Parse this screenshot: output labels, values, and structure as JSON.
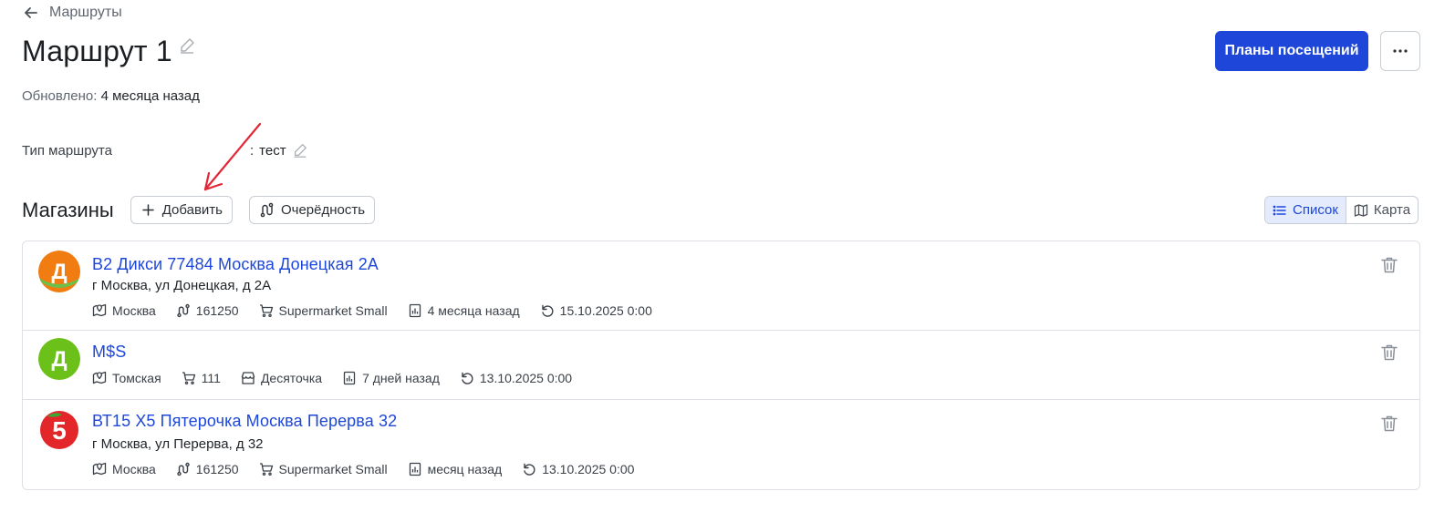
{
  "nav": {
    "back_label": "Маршруты"
  },
  "header": {
    "title": "Маршрут 1",
    "updated_label": "Обновлено:",
    "updated_value": "4 месяца назад",
    "primary_button": "Планы посещений"
  },
  "route_type": {
    "label": "Тип маршрута",
    "separator": ":",
    "value": "тест"
  },
  "stores": {
    "title": "Магазины",
    "add_button": "Добавить",
    "order_button": "Очерёдность",
    "view_list": "Список",
    "view_map": "Карта",
    "items": [
      {
        "name": "В2 Дикси 77484 Москва Донецкая 2А",
        "address": "г Москва, ул Донецкая, д 2А",
        "logo_letter": "Д",
        "region": "Москва",
        "route_code": "161250",
        "format": "Supermarket Small",
        "visited": "4 месяца назад",
        "next": "15.10.2025 0:00"
      },
      {
        "name": "M$S",
        "address": "",
        "logo_letter": "Д",
        "region": "Томская",
        "format": "111",
        "chain": "Десяточка",
        "visited": "7 дней назад",
        "next": "13.10.2025 0:00"
      },
      {
        "name": "ВТ15 Х5 Пятерочка Москва Перерва 32",
        "address": "г Москва, ул Перерва, д 32",
        "logo_letter": "5",
        "region": "Москва",
        "route_code": "161250",
        "format": "Supermarket Small",
        "visited": "месяц назад",
        "next": "13.10.2025 0:00"
      }
    ]
  },
  "colors": {
    "accent": "#1e47d9",
    "dixy_orange": "#f07c12",
    "dixy_green": "#6cc04a",
    "pyaterochka_red": "#e3262a"
  }
}
